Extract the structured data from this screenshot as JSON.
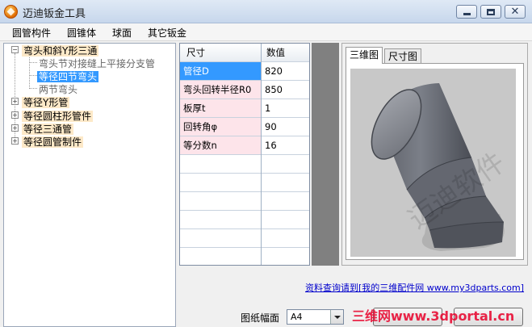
{
  "window": {
    "title": "迈迪钣金工具"
  },
  "menu": [
    "圆管构件",
    "圆锥体",
    "球面",
    "其它钣金"
  ],
  "tree": {
    "root": "弯头和斜Y形三通",
    "children": [
      "弯头节对接缝上平接分支管",
      "等径四节弯头",
      "两节弯头"
    ],
    "others": [
      "等径Y形管",
      "等径圆柱形管件",
      "等径三通管",
      "等径圆管制件"
    ]
  },
  "params": {
    "headers": [
      "尺寸",
      "数值"
    ],
    "rows": [
      {
        "label": "管径D",
        "value": "820"
      },
      {
        "label": "弯头回转半径R0",
        "value": "850"
      },
      {
        "label": "板厚t",
        "value": "1"
      },
      {
        "label": "回转角φ",
        "value": "90"
      },
      {
        "label": "等分数n",
        "value": "16"
      }
    ]
  },
  "tabs": [
    "三维图",
    "尺寸图"
  ],
  "link": "资料查询请到[我的三维配件网 www.my3dparts.com]",
  "paper": {
    "label": "图纸幅面",
    "value": "A4"
  },
  "watermark": "三维网www.3dportal.cn",
  "render_watermark": "迈迪软件",
  "colors": {
    "selection": "#3399ff",
    "label_bg": "#fde4ea",
    "highlight": "#fde9c8"
  }
}
